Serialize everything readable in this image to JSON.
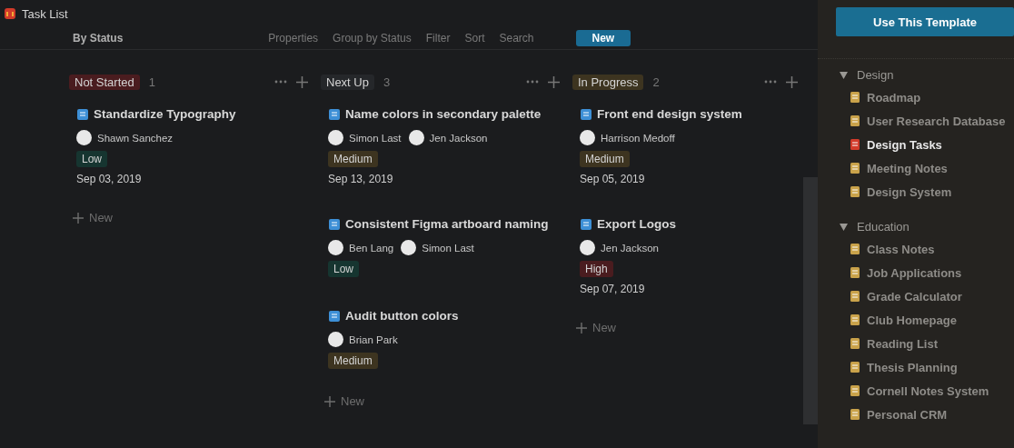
{
  "window": {
    "title": "Task List"
  },
  "toolbar": {
    "view": "By Status",
    "actions": [
      "Properties",
      "Group by Status",
      "Filter",
      "Sort",
      "Search"
    ],
    "new_button": "New"
  },
  "columns": [
    {
      "title": "Not Started",
      "color": "#4a1c1f",
      "count": "1",
      "new_label": "New",
      "cards": [
        {
          "title": "Standardize Typography",
          "people": [
            "Shawn Sanchez"
          ],
          "priority": {
            "label": "Low",
            "color": "#163530"
          },
          "date": "Sep 03, 2019"
        }
      ]
    },
    {
      "title": "Next Up",
      "color": "#25272a",
      "count": "3",
      "new_label": "New",
      "cards": [
        {
          "title": "Name colors in secondary palette",
          "people": [
            "Simon Last",
            "Jen Jackson"
          ],
          "priority": {
            "label": "Medium",
            "color": "#3d3420"
          },
          "date": "Sep 13, 2019"
        },
        {
          "title": "Consistent Figma artboard naming",
          "people": [
            "Ben Lang",
            "Simon Last"
          ],
          "priority": {
            "label": "Low",
            "color": "#163530"
          }
        },
        {
          "title": "Audit button colors",
          "people": [
            "Brian Park"
          ],
          "priority": {
            "label": "Medium",
            "color": "#3d3420"
          }
        }
      ]
    },
    {
      "title": "In Progress",
      "color": "#3d3420",
      "count": "2",
      "new_label": "New",
      "cards": [
        {
          "title": "Front end design system",
          "people": [
            "Harrison Medoff"
          ],
          "priority": {
            "label": "Medium",
            "color": "#3d3420"
          },
          "date": "Sep 05, 2019"
        },
        {
          "title": "Export Logos",
          "people": [
            "Jen Jackson"
          ],
          "priority": {
            "label": "High",
            "color": "#4a1c1f"
          },
          "date": "Sep 07, 2019"
        }
      ]
    }
  ],
  "sidebar": {
    "template_button": "Use This Template",
    "sections": [
      {
        "title": "Design",
        "expanded": true,
        "items": [
          {
            "label": "Roadmap",
            "selected": false
          },
          {
            "label": "User Research Database",
            "selected": false
          },
          {
            "label": "Design Tasks",
            "selected": true
          },
          {
            "label": "Meeting Notes",
            "selected": false
          },
          {
            "label": "Design System",
            "selected": false
          }
        ]
      },
      {
        "title": "Education",
        "expanded": true,
        "items": [
          {
            "label": "Class Notes",
            "selected": false
          },
          {
            "label": "Job Applications",
            "selected": false
          },
          {
            "label": "Grade Calculator",
            "selected": false
          },
          {
            "label": "Club Homepage",
            "selected": false
          },
          {
            "label": "Reading List",
            "selected": false
          },
          {
            "label": "Thesis Planning",
            "selected": false
          },
          {
            "label": "Cornell Notes System",
            "selected": false
          },
          {
            "label": "Personal CRM",
            "selected": false
          }
        ]
      }
    ]
  }
}
